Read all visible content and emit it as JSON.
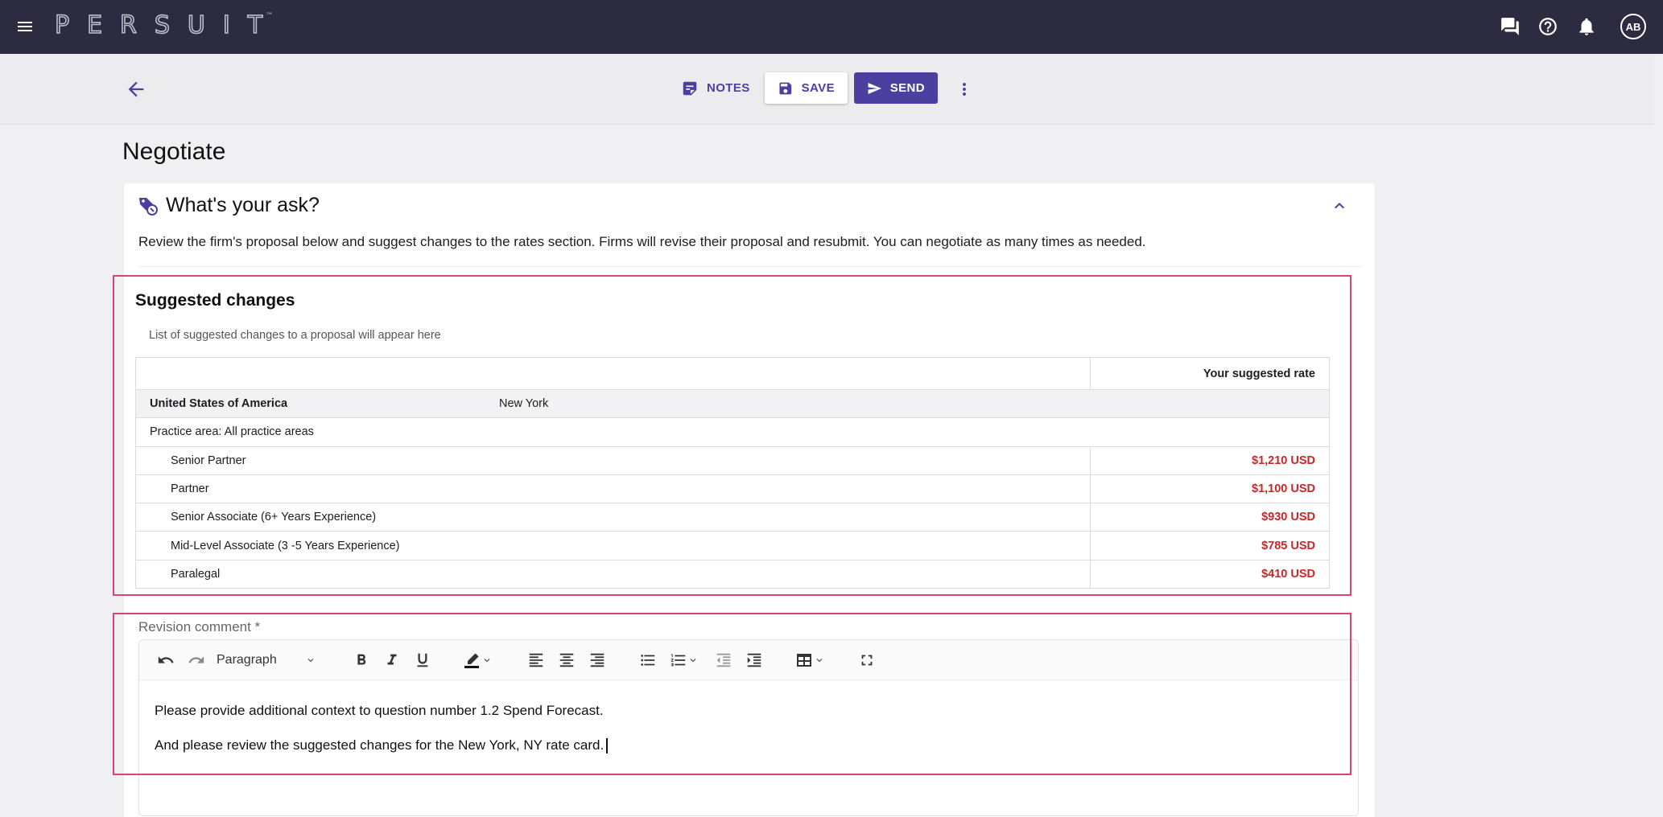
{
  "app": {
    "logo_text": "PERSUIT",
    "logo_mark": "™",
    "avatar_initials": "AB"
  },
  "icons": {
    "menu": "menu-icon",
    "chat": "chat-icon",
    "help": "help-icon",
    "notifications": "bell-icon",
    "back": "arrow-back-icon",
    "notes": "notes-icon",
    "save": "floppy-disk-icon",
    "send": "send-icon",
    "more": "more-vert-icon",
    "section": "tags-icon",
    "collapse": "chevron-up-icon"
  },
  "toolbar": {
    "notes_label": "NOTES",
    "save_label": "SAVE",
    "send_label": "SEND"
  },
  "page": {
    "title": "Negotiate"
  },
  "ask": {
    "title": "What's your ask?",
    "description": "Review the firm's proposal below and suggest changes to the rates section. Firms will revise their proposal and resubmit. You can negotiate as many times as needed."
  },
  "suggested": {
    "title": "Suggested changes",
    "subtitle": "List of suggested changes to a proposal will appear here",
    "table": {
      "header_rate": "Your suggested rate",
      "country": "United States of America",
      "city": "New York",
      "practice_area": "Practice area: All practice areas",
      "rows": [
        {
          "role": "Senior Partner",
          "rate": "$1,210 USD"
        },
        {
          "role": "Partner",
          "rate": "$1,100 USD"
        },
        {
          "role": "Senior Associate (6+ Years Experience)",
          "rate": "$930 USD"
        },
        {
          "role": "Mid-Level Associate (3 -5 Years Experience)",
          "rate": "$785 USD"
        },
        {
          "role": "Paralegal",
          "rate": "$410 USD"
        }
      ]
    }
  },
  "revision": {
    "label": "Revision comment *",
    "paragraph_select": "Paragraph",
    "lines": [
      "Please provide additional context to question number 1.2 Spend Forecast.",
      "And please review the suggested changes for the New York, NY rate card."
    ]
  },
  "colors": {
    "appbar": "#2d2b40",
    "accent": "#4b3fa0",
    "highlight": "#d4457a",
    "rate_red": "#c62828"
  }
}
